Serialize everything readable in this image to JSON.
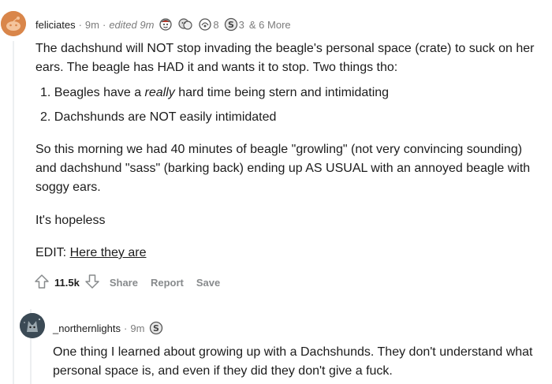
{
  "comment": {
    "username": "feliciates",
    "time": "9m",
    "edited": "edited 9m",
    "awards": [
      {
        "icon": "wholesome-seal-award-icon"
      },
      {
        "icon": "hug-award-icon"
      },
      {
        "icon": "helpful-award-icon",
        "count": "8"
      },
      {
        "icon": "silver-award-icon",
        "count": "3"
      }
    ],
    "more_awards": "& 6 More",
    "body_p1": "The dachshund will NOT stop invading the beagle's personal space (crate) to suck on her ears. The beagle has HAD it and wants it to stop. Two things tho:",
    "list": [
      {
        "num": "1.",
        "before": "Beagles have a ",
        "em": "really",
        "after": " hard time being stern and intimidating"
      },
      {
        "num": "2.",
        "before": "Dachshunds are NOT easily intimidated",
        "em": "",
        "after": ""
      }
    ],
    "body_p2": "So this morning we had 40 minutes of beagle \"growling\" (not very convincing sounding) and dachshund \"sass\" (barking back) ending up AS USUAL with an annoyed beagle with soggy ears.",
    "body_p3": "It's hopeless",
    "edit_prefix": "EDIT: ",
    "edit_link": "Here they are",
    "score": "11.5k",
    "actions": {
      "share": "Share",
      "report": "Report",
      "save": "Save"
    }
  },
  "reply": {
    "username": "_northernlights",
    "time": "9m",
    "award_icon": "silver-award-icon",
    "body": "One thing I learned about growing up with a Dachshunds. They don't understand what personal space is, and even if they did they don't give a fuck."
  },
  "colors": {
    "text": "#1c1c1c",
    "meta": "#7c7c7c",
    "action": "#878a8c",
    "avatar": "#d9864a",
    "thread_line": "#edeff1"
  }
}
